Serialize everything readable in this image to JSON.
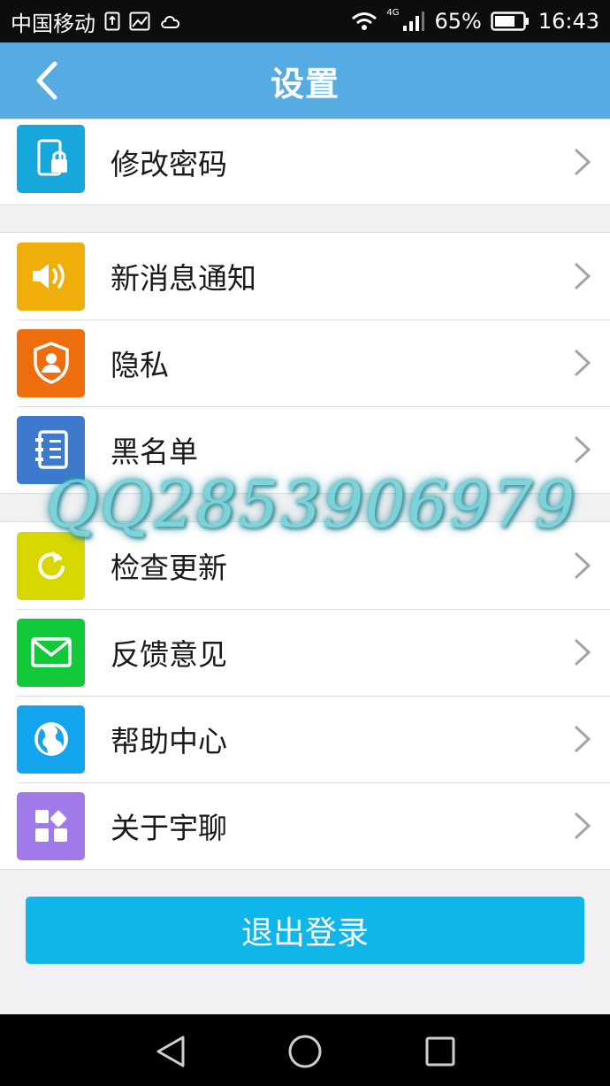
{
  "status_bar": {
    "carrier": "中国移动",
    "network": "4G",
    "battery": "65%",
    "time": "16:43"
  },
  "header": {
    "title": "设置"
  },
  "groups": [
    {
      "items": [
        {
          "label": "修改密码",
          "icon": "phone-lock-icon",
          "color": "#16a8db"
        }
      ]
    },
    {
      "items": [
        {
          "label": "新消息通知",
          "icon": "speaker-icon",
          "color": "#f0ae0a"
        },
        {
          "label": "隐私",
          "icon": "shield-user-icon",
          "color": "#ee6d0c"
        },
        {
          "label": "黑名单",
          "icon": "notebook-icon",
          "color": "#3d79cc"
        }
      ]
    },
    {
      "items": [
        {
          "label": "检查更新",
          "icon": "refresh-icon",
          "color": "#d8d800"
        },
        {
          "label": "反馈意见",
          "icon": "mail-icon",
          "color": "#12c93a"
        },
        {
          "label": "帮助中心",
          "icon": "globe-icon",
          "color": "#13a4ee"
        },
        {
          "label": "关于宇聊",
          "icon": "apps-icon",
          "color": "#a07ae8"
        }
      ]
    }
  ],
  "logout": {
    "label": "退出登录",
    "color": "#0eb6ea"
  },
  "watermark": "QQ2853906979",
  "colors": {
    "nav_bar": "#55abe2",
    "background": "#f1f1f3"
  }
}
